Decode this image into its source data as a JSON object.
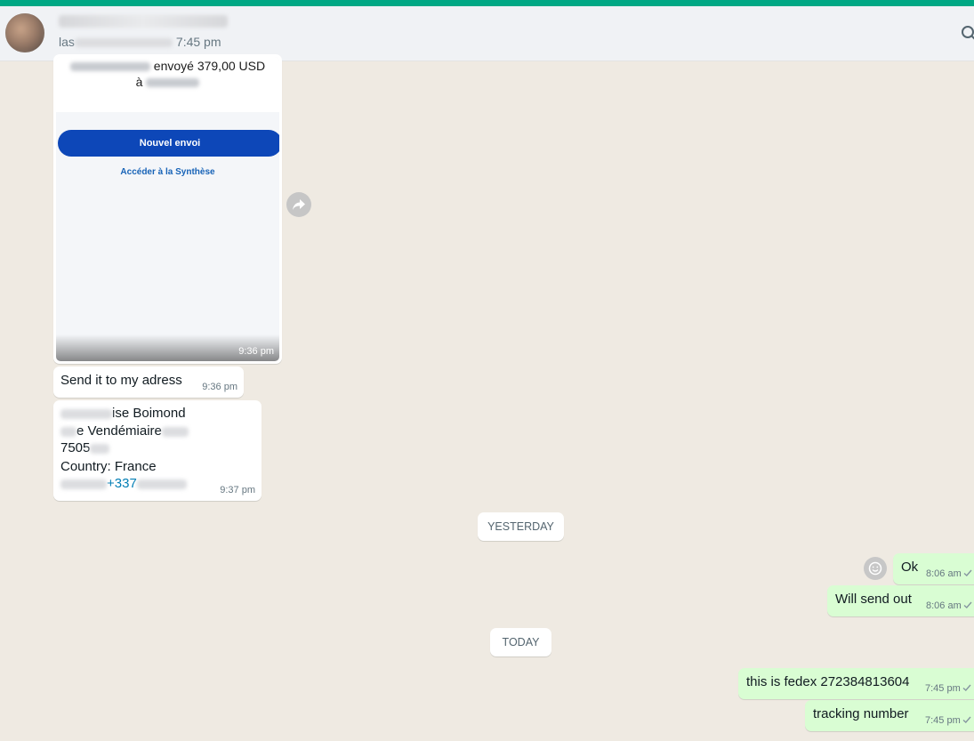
{
  "header": {
    "contact_name": "",
    "status_prefix": "las",
    "status_time": "7:45 pm",
    "icons": {
      "avatar": "avatar",
      "search": "search-icon"
    }
  },
  "messages": {
    "image_msg": {
      "line1_visible": "envoyé 379,00 USD",
      "line2_visible": "à",
      "button_label": "Nouvel envoi",
      "link_label": "Accéder à la Synthèse",
      "time": "9:36 pm"
    },
    "send_address": {
      "text": "Send it to my adress",
      "time": "9:36 pm"
    },
    "address": {
      "line1_visible": "ise Boimond",
      "line2_visible": "e Vendémiaire",
      "line3_visible": "7505",
      "country": "Country: France",
      "phone_visible": "+337",
      "time": "9:37 pm"
    },
    "chip_yesterday": "YESTERDAY",
    "ok": {
      "text": "Ok",
      "time": "8:06 am"
    },
    "will_send": {
      "text": "Will send out",
      "time": "8:06 am"
    },
    "chip_today": "TODAY",
    "fedex": {
      "text": "this is fedex 272384813604",
      "time": "7:45 pm"
    },
    "tracking": {
      "text": "tracking number",
      "time": "7:45 pm"
    }
  },
  "colors": {
    "accent": "#00a884",
    "incoming_bubble": "#ffffff",
    "outgoing_bubble": "#d9fdd3",
    "chat_bg": "#efeae2",
    "button_blue": "#0d47b8"
  }
}
